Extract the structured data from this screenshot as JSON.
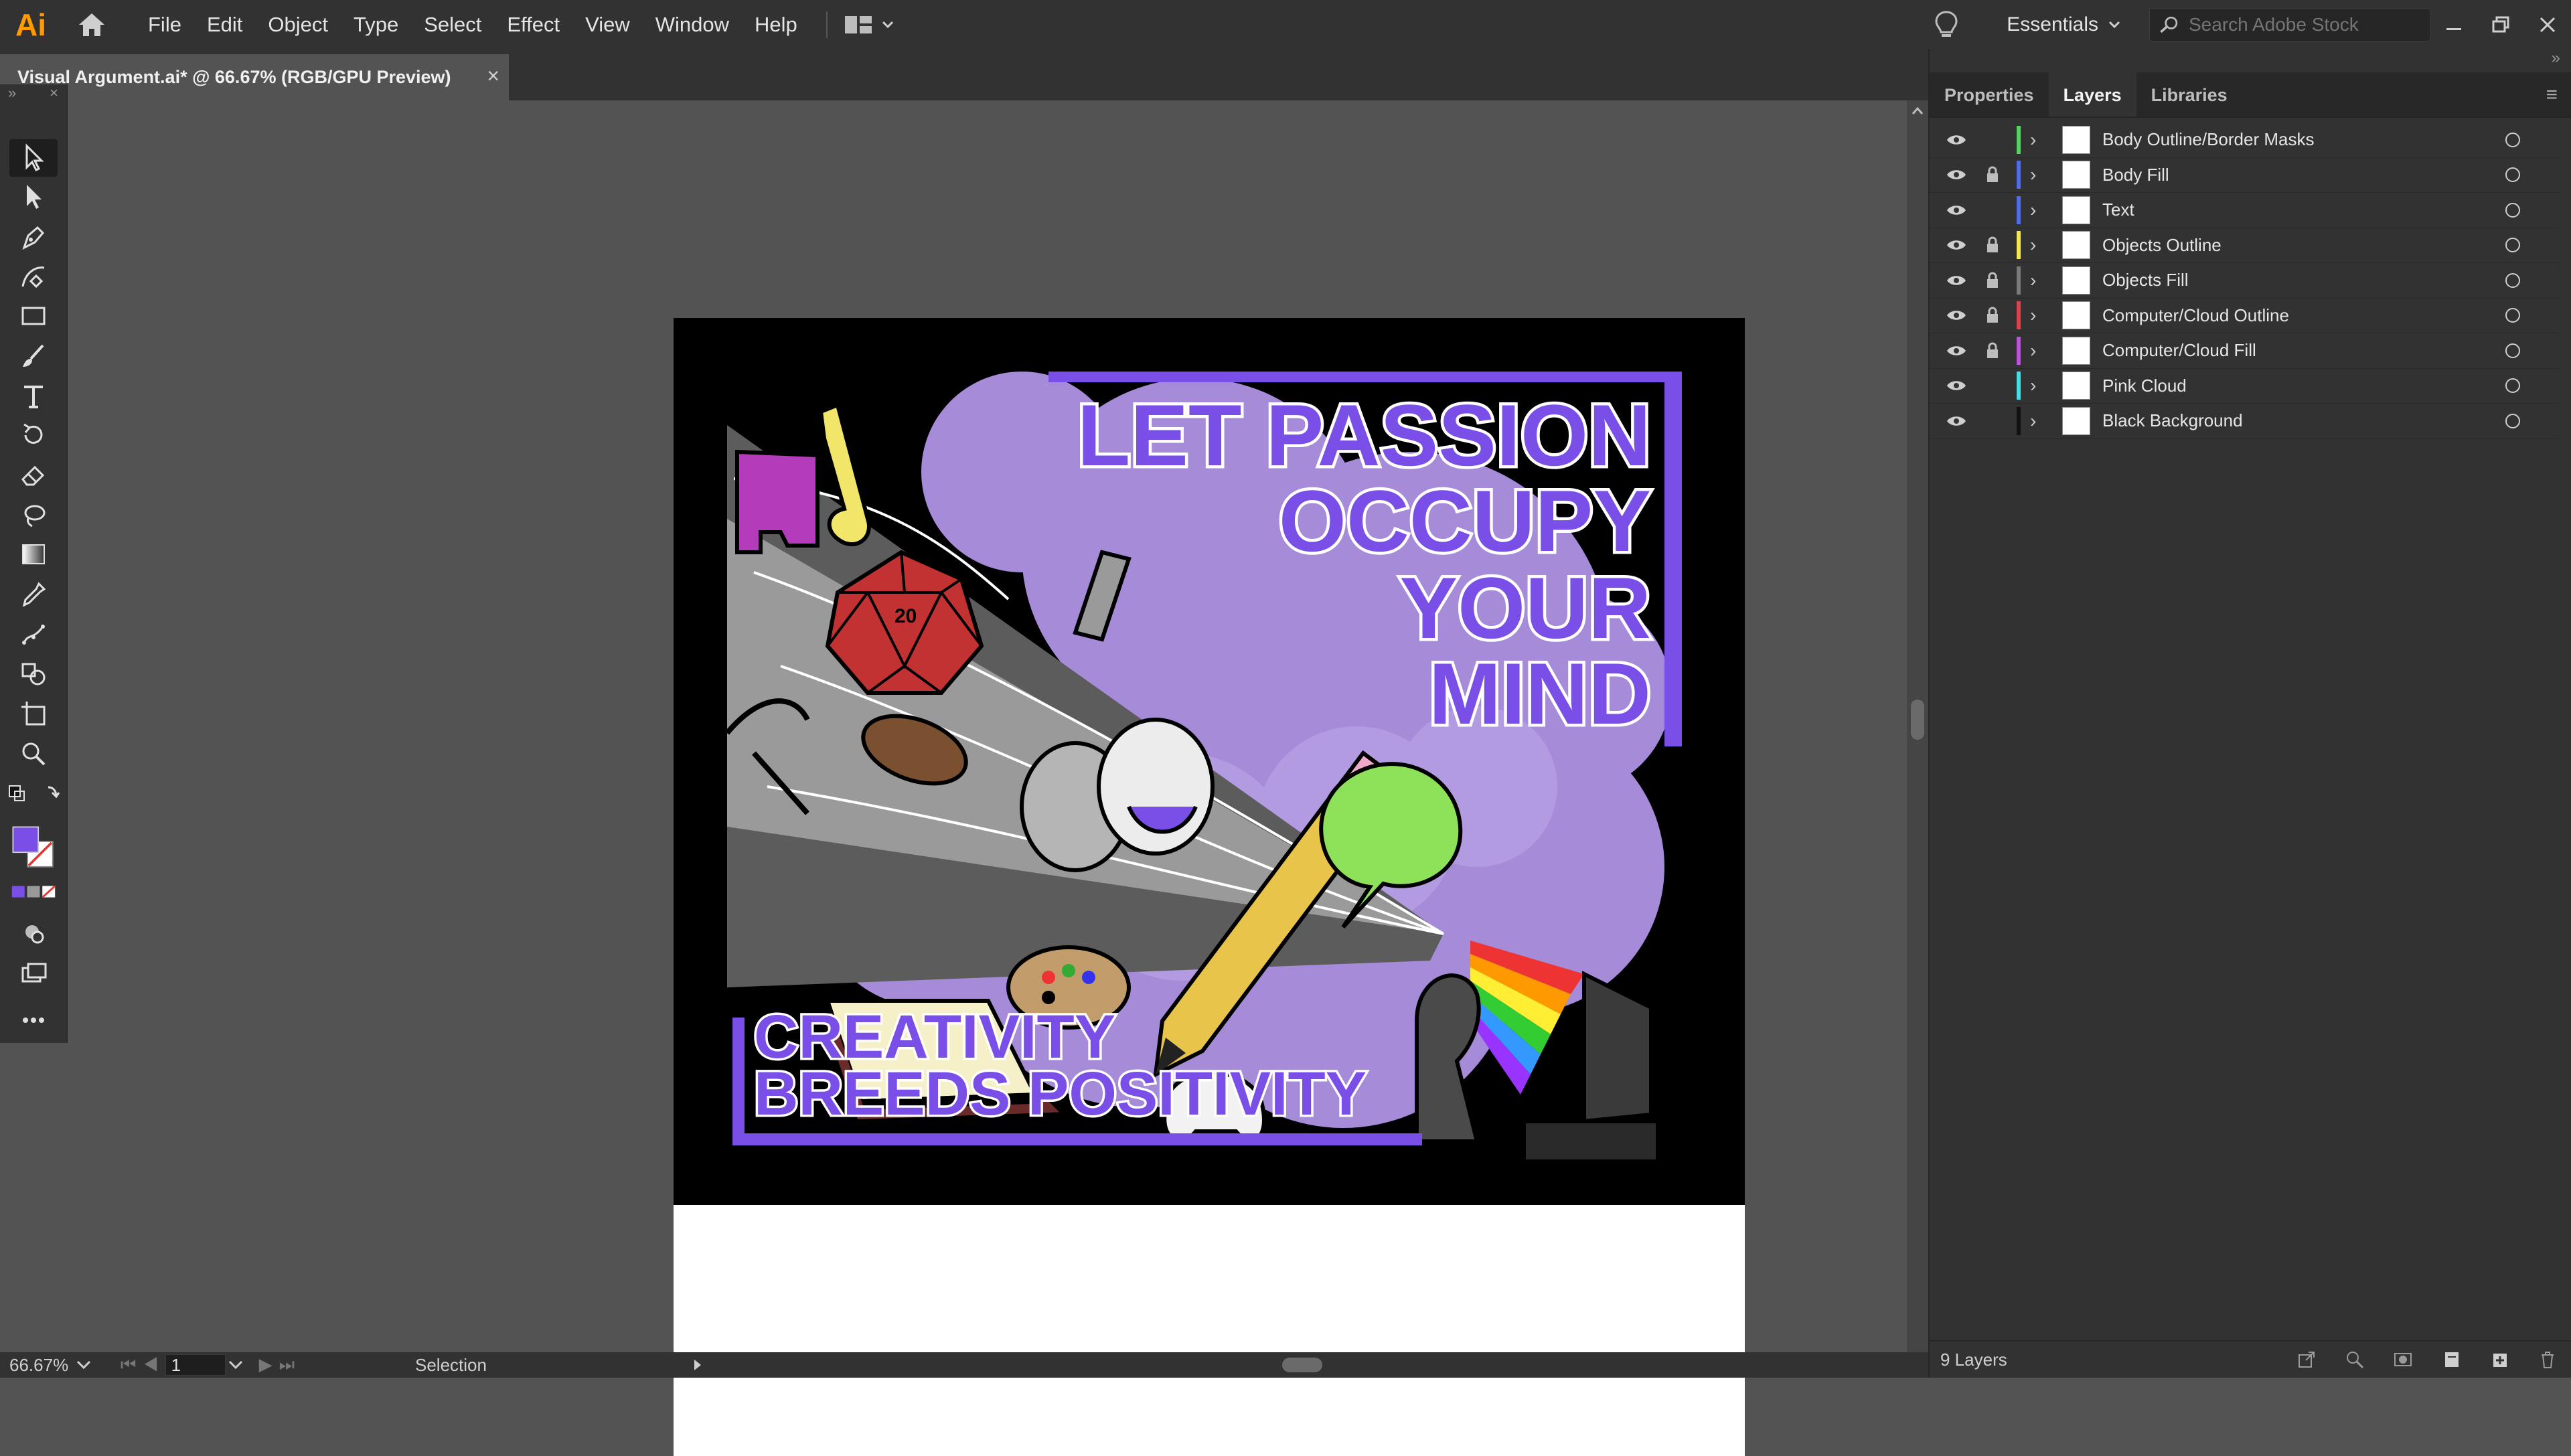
{
  "app": {
    "logo": "Ai",
    "brand_color": "#ff9a00"
  },
  "menu": {
    "items": [
      "File",
      "Edit",
      "Object",
      "Type",
      "Select",
      "Effect",
      "View",
      "Window",
      "Help"
    ],
    "workspace": "Essentials",
    "search_placeholder": "Search Adobe Stock"
  },
  "document": {
    "tab_title": "Visual Argument.ai* @ 66.67% (RGB/GPU Preview)",
    "close": "×"
  },
  "artwork": {
    "headline": [
      "LET PASSION",
      "OCCUPY",
      "YOUR",
      "MIND"
    ],
    "tagline": [
      "CREATIVITY",
      "BREEDS POSITIVITY"
    ],
    "d20_label": "20",
    "accent": "#7a4fe8",
    "cloud": "#a58bd8"
  },
  "status": {
    "zoom": "66.67%",
    "artboard": "1",
    "tool": "Selection"
  },
  "panel": {
    "tabs": [
      "Properties",
      "Layers",
      "Libraries"
    ],
    "active_tab": "Layers",
    "layers": [
      {
        "name": "Body Outline/Border Masks",
        "color": "#4fd65c",
        "locked": false
      },
      {
        "name": "Body Fill",
        "color": "#4f6df0",
        "locked": true
      },
      {
        "name": "Text",
        "color": "#4f6df0",
        "locked": false
      },
      {
        "name": "Objects Outline",
        "color": "#f5e84a",
        "locked": true
      },
      {
        "name": "Objects Fill",
        "color": "#7a7a7a",
        "locked": true
      },
      {
        "name": "Computer/Cloud Outline",
        "color": "#e0404a",
        "locked": true
      },
      {
        "name": "Computer/Cloud Fill",
        "color": "#c050e0",
        "locked": true
      },
      {
        "name": "Pink Cloud",
        "color": "#40e0e6",
        "locked": false
      },
      {
        "name": "Black Background",
        "color": "#111111",
        "locked": false
      }
    ],
    "footer": "9 Layers"
  }
}
